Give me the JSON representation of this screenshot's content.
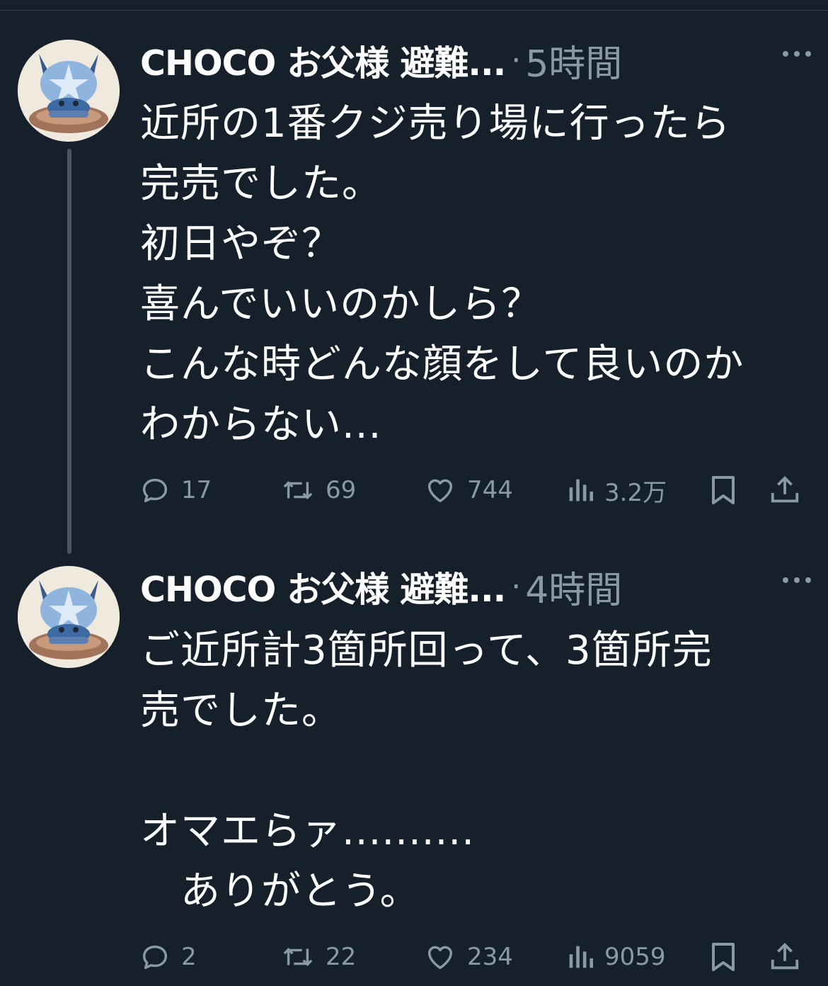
{
  "colors": {
    "background": "#15202b",
    "text": "#ffffff",
    "muted": "#8b98a5",
    "thread_line": "#4a5560"
  },
  "tweets": [
    {
      "author": "CHOCO お父様 避難...",
      "separator": "·",
      "time": "5時間",
      "text": "近所の1番クジ売り場に行ったら\n完売でした。\n初日やぞ？\n喜んでいいのかしら？\nこんな時どんな顔をして良いのか\nわからない...",
      "reply_count": "17",
      "retweet_count": "69",
      "like_count": "744",
      "view_count": "3.2万"
    },
    {
      "author": "CHOCO お父様 避難...",
      "separator": "·",
      "time": "4時間",
      "text": "ご近所計3箇所回って、3箇所完\n売でした。\n\nオマエらァ..........\n　ありがとう。",
      "reply_count": "2",
      "retweet_count": "22",
      "like_count": "234",
      "view_count": "9059"
    }
  ],
  "icons": {
    "more": "more-horizontal-icon",
    "reply": "reply-bubble-icon",
    "retweet": "retweet-icon",
    "like": "heart-icon",
    "views": "views-bars-icon",
    "bookmark": "bookmark-icon",
    "share": "share-icon"
  }
}
